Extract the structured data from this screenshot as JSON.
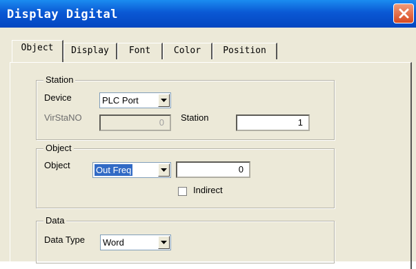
{
  "window": {
    "title": "Display Digital",
    "close_icon": "close-icon"
  },
  "tabs": [
    {
      "label": "Object",
      "active": true
    },
    {
      "label": "Display",
      "active": false
    },
    {
      "label": "Font",
      "active": false
    },
    {
      "label": "Color",
      "active": false
    },
    {
      "label": "Position",
      "active": false
    }
  ],
  "station_group": {
    "legend": "Station",
    "device_label": "Device",
    "device_value": "PLC Port",
    "virstano_label": "VirStaNO",
    "virstano_value": "0",
    "station_label": "Station",
    "station_value": "1"
  },
  "object_group": {
    "legend": "Object",
    "object_label": "Object",
    "object_value": "Out Freq",
    "address_value": "0",
    "indirect_label": "Indirect",
    "indirect_checked": false
  },
  "data_group": {
    "legend": "Data",
    "datatype_label": "Data Type",
    "datatype_value": "Word"
  },
  "colors": {
    "title_bar": "#0a58d4",
    "dialog_bg": "#ece9d8",
    "selection": "#316ac5",
    "close_button": "#d84a21"
  }
}
